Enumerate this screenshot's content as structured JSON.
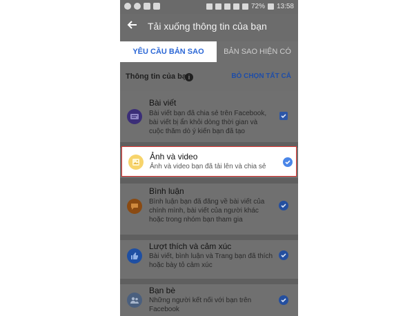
{
  "status_bar": {
    "battery": "72%",
    "time": "13:58"
  },
  "header": {
    "title": "Tải xuống thông tin của bạn",
    "back_icon": "arrow-left-icon"
  },
  "tabs": [
    {
      "label": "YÊU CẦU BẢN SAO",
      "active": true
    },
    {
      "label": "BẢN SAO HIỆN CÓ",
      "active": false
    }
  ],
  "section": {
    "label": "Thông tin của bạn",
    "info_icon": "i",
    "deselect_all": "BỎ CHỌN TẤT CẢ"
  },
  "items": [
    {
      "title": "Bài viết",
      "description": "Bài viết bạn đã chia sẻ trên Facebook, bài viết bị ẩn khỏi dòng thời gian và cuộc thăm dò ý kiến bạn đã tạo",
      "icon": "posts-icon",
      "icon_color": "#3b2e78",
      "checked": true
    },
    {
      "title": "Ảnh và video",
      "description": "Ảnh và video bạn đã tải lên và chia sẻ",
      "icon": "photos-icon",
      "icon_color": "#f7d46b",
      "checked": true
    },
    {
      "title": "Bình luận",
      "description": "Bình luận bạn đã đăng về bài viết của chính mình, bài viết của người khác hoặc trong nhóm bạn tham gia",
      "icon": "comments-icon",
      "icon_color": "#8a4a12",
      "checked": true
    },
    {
      "title": "Lượt thích và cảm xúc",
      "description": "Bài viết, bình luận và Trang bạn đã thích hoặc bày tỏ cảm xúc",
      "icon": "like-icon",
      "icon_color": "#1e4fa3",
      "checked": true
    },
    {
      "title": "Bạn bè",
      "description": "Những người kết nối với bạn trên Facebook",
      "icon": "friends-icon",
      "icon_color": "#4a5f7e",
      "checked": true
    }
  ]
}
